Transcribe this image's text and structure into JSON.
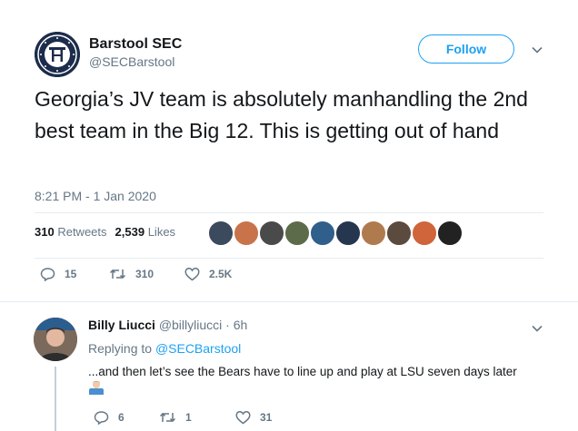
{
  "tweet": {
    "author_name": "Barstool SEC",
    "author_handle": "@SECBarstool",
    "follow_label": "Follow",
    "text": "Georgia’s JV team is absolutely manhandling the 2nd best team in the Big 12. This is getting out of hand",
    "timestamp": "8:21 PM - 1 Jan 2020",
    "retweets_count": "310",
    "retweets_label": "Retweets",
    "likes_count": "2,539",
    "likes_label": "Likes",
    "actions": {
      "reply": "15",
      "retweet": "310",
      "like": "2.5K"
    }
  },
  "reply": {
    "author_name": "Billy Liucci",
    "author_meta": "@billyliucci · 6h",
    "replying_prefix": "Replying to",
    "replying_handle": "@SECBarstool",
    "text": "...and then let’s see the Bears have to line up and play at LSU seven days later",
    "actions": {
      "reply": "6",
      "retweet": "1",
      "like": "31"
    }
  },
  "icons": {
    "avatar": "barstool-logo-icon",
    "reply": "reply-icon",
    "retweet": "retweet-icon",
    "like": "heart-icon",
    "more": "chevron-down-icon",
    "emoji": "man-shrugging-emoji-icon"
  },
  "colors": {
    "accent": "#1da1f2",
    "secondary_text": "#657786",
    "primary_text": "#14171a",
    "divider": "#e6ecf0"
  }
}
